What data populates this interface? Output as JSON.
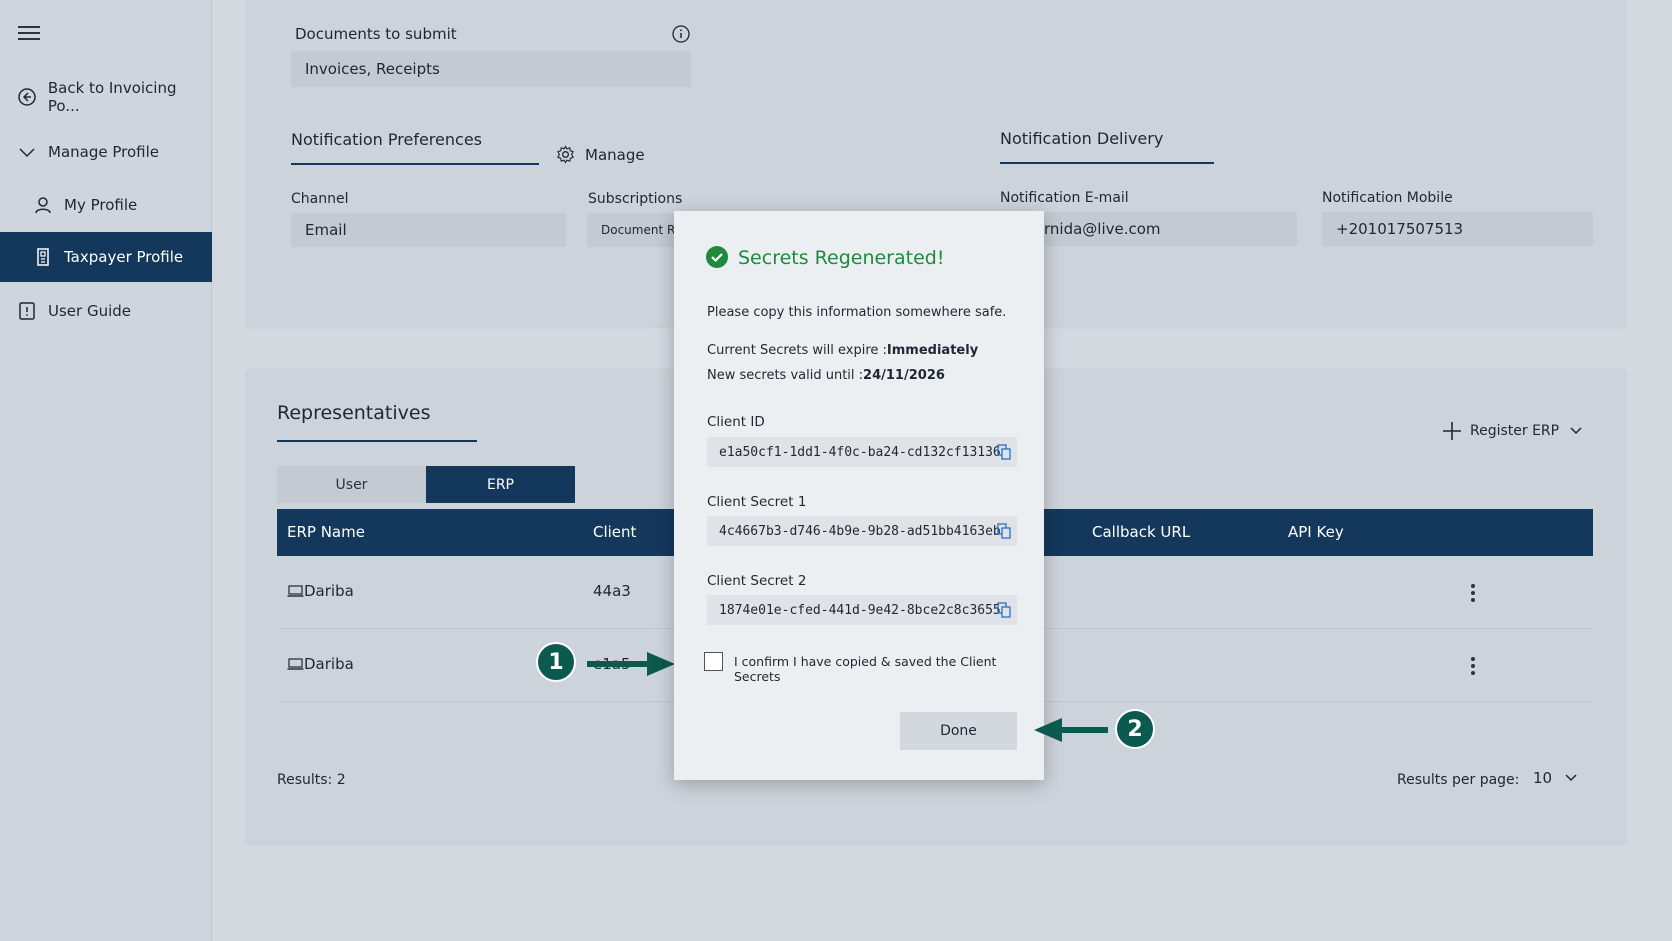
{
  "sidebar": {
    "items": [
      {
        "label": "Back to Invoicing Po...",
        "icon": "arrow-left-circle-icon"
      },
      {
        "label": "Manage Profile",
        "icon": "chevron-down-icon"
      },
      {
        "label": "My Profile",
        "icon": "user-icon"
      },
      {
        "label": "Taxpayer Profile",
        "icon": "id-card-icon",
        "active": true
      },
      {
        "label": "User Guide",
        "icon": "book-icon"
      }
    ]
  },
  "documents": {
    "label": "Documents to submit",
    "value": "Invoices, Receipts"
  },
  "notification_preferences": {
    "title": "Notification Preferences",
    "manage_label": "Manage",
    "channel_label": "Channel",
    "channel_value": "Email",
    "subscriptions_label": "Subscriptions",
    "subscriptions_value": "Document Rec"
  },
  "notification_delivery": {
    "title": "Notification Delivery",
    "email_label": "Notification E-mail",
    "email_value": "rnida@live.com",
    "mobile_label": "Notification Mobile",
    "mobile_value": "+201017507513"
  },
  "representatives": {
    "title": "Representatives",
    "register_label": "Register ERP",
    "tabs": [
      "User",
      "ERP"
    ],
    "columns": [
      "ERP Name",
      "Client",
      "Callback URL",
      "API Key"
    ],
    "rows": [
      {
        "erp_name": "Dariba",
        "client": "44a3"
      },
      {
        "erp_name": "Dariba",
        "client": "e1a5"
      }
    ],
    "results": "Results: 2",
    "per_page_label": "Results per page:",
    "per_page_value": "10"
  },
  "modal": {
    "title": "Secrets Regenerated!",
    "instruction": "Please copy this information somewhere safe.",
    "expire_prefix": "Current Secrets will expire :",
    "expire_value": "Immediately",
    "valid_prefix": "New secrets valid until :",
    "valid_value": "24/11/2026",
    "client_id_label": "Client ID",
    "client_id_value": "e1a50cf1-1dd1-4f0c-ba24-cd132cf13136",
    "secret1_label": "Client Secret 1",
    "secret1_value": "4c4667b3-d746-4b9e-9b28-ad51bb4163eb",
    "secret2_label": "Client Secret 2",
    "secret2_value": "1874e01e-cfed-441d-9e42-8bce2c8c3655",
    "confirm_label": "I confirm I have copied & saved the Client Secrets",
    "done_label": "Done"
  },
  "annotations": {
    "one": "1",
    "two": "2"
  },
  "colors": {
    "primary": "#14385c",
    "success": "#1f8a3c",
    "annotation": "#0c5a4f"
  }
}
